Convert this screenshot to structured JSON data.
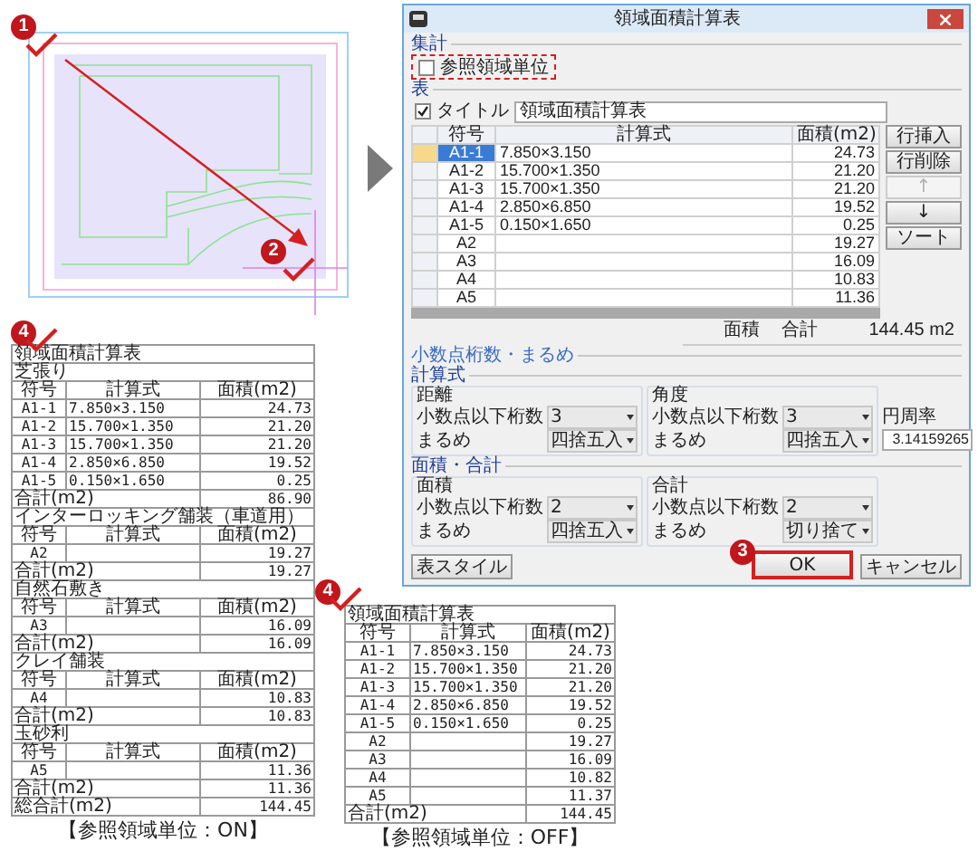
{
  "drawing": {
    "markers": [
      "1",
      "2"
    ]
  },
  "dialog": {
    "title": "領域面積計算表",
    "aggregate": {
      "label": "集計",
      "checkbox": {
        "label": "参照領域単位",
        "checked": false,
        "highlighted": true
      }
    },
    "table_section": {
      "label": "表",
      "title_checkbox": {
        "label": "タイトル",
        "checked": true
      },
      "title_value": "領域面積計算表",
      "columns": [
        "符号",
        "計算式",
        "面積(m2)"
      ],
      "rows": [
        {
          "cells": [
            "A1-1",
            "7.850×3.150",
            "24.73"
          ],
          "selected": true
        },
        {
          "cells": [
            "A1-2",
            "15.700×1.350",
            "21.20"
          ],
          "selected": false
        },
        {
          "cells": [
            "A1-3",
            "15.700×1.350",
            "21.20"
          ],
          "selected": false
        },
        {
          "cells": [
            "A1-4",
            "2.850×6.850",
            "19.52"
          ],
          "selected": false
        },
        {
          "cells": [
            "A1-5",
            "0.150×1.650",
            "0.25"
          ],
          "selected": false
        },
        {
          "cells": [
            "A2",
            "",
            "19.27"
          ],
          "selected": false
        },
        {
          "cells": [
            "A3",
            "",
            "16.09"
          ],
          "selected": false
        },
        {
          "cells": [
            "A4",
            "",
            "10.83"
          ],
          "selected": false
        },
        {
          "cells": [
            "A5",
            "",
            "11.36"
          ],
          "selected": false
        }
      ]
    },
    "side_buttons": [
      {
        "label": "行挿入",
        "disabled": false
      },
      {
        "label": "行削除",
        "disabled": false
      },
      {
        "label": "↑",
        "disabled": true
      },
      {
        "label": "↓",
        "disabled": false
      },
      {
        "label": "ソート",
        "disabled": false
      }
    ],
    "total": {
      "label": "面積",
      "sublabel": "合計",
      "value": "144.45 m2"
    },
    "rounding": {
      "label": "小数点桁数・まるめ",
      "sections": [
        {
          "label": "計算式",
          "groups": [
            {
              "label": "距離",
              "rows": [
                {
                  "label": "小数点以下桁数",
                  "value": "3"
                },
                {
                  "label": "まるめ",
                  "value": "四捨五入"
                }
              ]
            },
            {
              "label": "角度",
              "rows": [
                {
                  "label": "小数点以下桁数",
                  "value": "3"
                },
                {
                  "label": "まるめ",
                  "value": "四捨五入"
                }
              ]
            }
          ],
          "pi": {
            "label": "円周率",
            "value": "3.14159265"
          }
        },
        {
          "label": "面積・合計",
          "groups": [
            {
              "label": "面積",
              "rows": [
                {
                  "label": "小数点以下桁数",
                  "value": "2"
                },
                {
                  "label": "まるめ",
                  "value": "四捨五入"
                }
              ]
            },
            {
              "label": "合計",
              "rows": [
                {
                  "label": "小数点以下桁数",
                  "value": "2"
                },
                {
                  "label": "まるめ",
                  "value": "切り捨て"
                }
              ]
            }
          ]
        }
      ]
    },
    "style_button": "表スタイル",
    "ok_button": {
      "label": "OK",
      "marker": "3",
      "highlighted": true
    },
    "cancel_button": "キャンセル"
  },
  "on_table": {
    "marker": "4",
    "title": "領域面積計算表",
    "groups": [
      {
        "name": "芝張り",
        "columns": [
          "符号",
          "計算式",
          "面積(m2)"
        ],
        "rows": [
          [
            "A1-1",
            "7.850×3.150",
            "24.73"
          ],
          [
            "A1-2",
            "15.700×1.350",
            "21.20"
          ],
          [
            "A1-3",
            "15.700×1.350",
            "21.20"
          ],
          [
            "A1-4",
            "2.850×6.850",
            "19.52"
          ],
          [
            "A1-5",
            "0.150×1.650",
            "0.25"
          ]
        ],
        "subtotal": {
          "label": "合計(m2)",
          "value": "86.90"
        }
      },
      {
        "name": "インターロッキング舗装（車道用）",
        "columns": [
          "符号",
          "計算式",
          "面積(m2)"
        ],
        "rows": [
          [
            "A2",
            "",
            "19.27"
          ]
        ],
        "subtotal": {
          "label": "合計(m2)",
          "value": "19.27"
        }
      },
      {
        "name": "自然石敷き",
        "columns": [
          "符号",
          "計算式",
          "面積(m2)"
        ],
        "rows": [
          [
            "A3",
            "",
            "16.09"
          ]
        ],
        "subtotal": {
          "label": "合計(m2)",
          "value": "16.09"
        }
      },
      {
        "name": "クレイ舗装",
        "columns": [
          "符号",
          "計算式",
          "面積(m2)"
        ],
        "rows": [
          [
            "A4",
            "",
            "10.83"
          ]
        ],
        "subtotal": {
          "label": "合計(m2)",
          "value": "10.83"
        }
      },
      {
        "name": "玉砂利",
        "columns": [
          "符号",
          "計算式",
          "面積(m2)"
        ],
        "rows": [
          [
            "A5",
            "",
            "11.36"
          ]
        ],
        "subtotal": {
          "label": "合計(m2)",
          "value": "11.36"
        }
      }
    ],
    "grand_total": {
      "label": "総合計(m2)",
      "value": "144.45"
    },
    "caption": "【参照領域単位：ON】"
  },
  "off_table": {
    "marker": "4",
    "title": "領域面積計算表",
    "columns": [
      "符号",
      "計算式",
      "面積(m2)"
    ],
    "rows": [
      [
        "A1-1",
        "7.850×3.150",
        "24.73"
      ],
      [
        "A1-2",
        "15.700×1.350",
        "21.20"
      ],
      [
        "A1-3",
        "15.700×1.350",
        "21.20"
      ],
      [
        "A1-4",
        "2.850×6.850",
        "19.52"
      ],
      [
        "A1-5",
        "0.150×1.650",
        "0.25"
      ],
      [
        "A2",
        "",
        "19.27"
      ],
      [
        "A3",
        "",
        "16.09"
      ],
      [
        "A4",
        "",
        "10.82"
      ],
      [
        "A5",
        "",
        "11.37"
      ]
    ],
    "total": {
      "label": "合計(m2)",
      "value": "144.45"
    },
    "caption": "【参照領域単位：OFF】"
  }
}
